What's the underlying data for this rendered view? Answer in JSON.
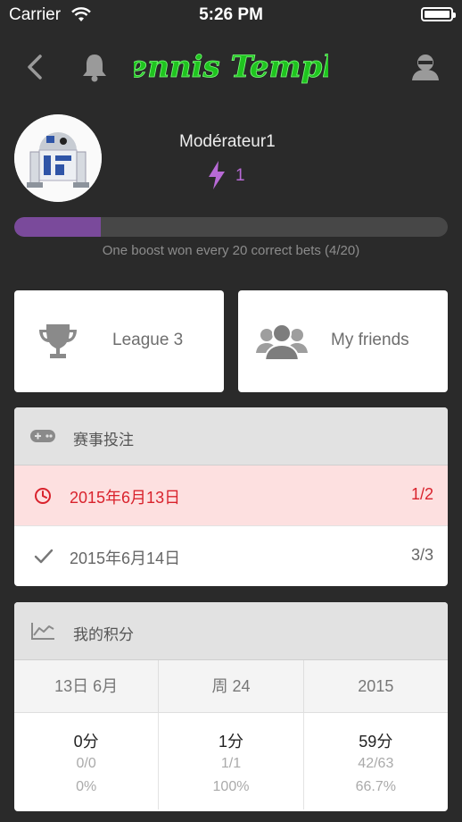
{
  "status_bar": {
    "carrier": "Carrier",
    "time": "5:26 PM"
  },
  "nav": {
    "logo_text": "Tennis Temple",
    "icons": [
      "back-icon",
      "bell-icon",
      "user-icon"
    ]
  },
  "profile": {
    "username": "Modérateur1",
    "boosts": "1",
    "progress_fraction": 0.2,
    "progress_caption": "One boost won every 20 correct bets (4/20)"
  },
  "cards": {
    "league_label": "League 3",
    "friends_label": "My friends"
  },
  "bets": {
    "title": "赛事投注",
    "rows": [
      {
        "date": "2015年6月13日",
        "fraction": "1/2",
        "status": "pending"
      },
      {
        "date": "2015年6月14日",
        "fraction": "3/3",
        "status": "done"
      }
    ]
  },
  "scores": {
    "title": "我的积分",
    "columns": [
      {
        "header": "13日 6月",
        "points": "0分",
        "ratio": "0/0",
        "percent": "0%"
      },
      {
        "header": "周 24",
        "points": "1分",
        "ratio": "1/1",
        "percent": "100%"
      },
      {
        "header": "2015",
        "points": "59分",
        "ratio": "42/63",
        "percent": "66.7%"
      }
    ]
  },
  "colors": {
    "accent": "#7a4a9b",
    "boost": "#b86ad6",
    "pending_bg": "#fde0e0",
    "pending_text": "#d9232d",
    "logo_green": "#1fc41f"
  }
}
